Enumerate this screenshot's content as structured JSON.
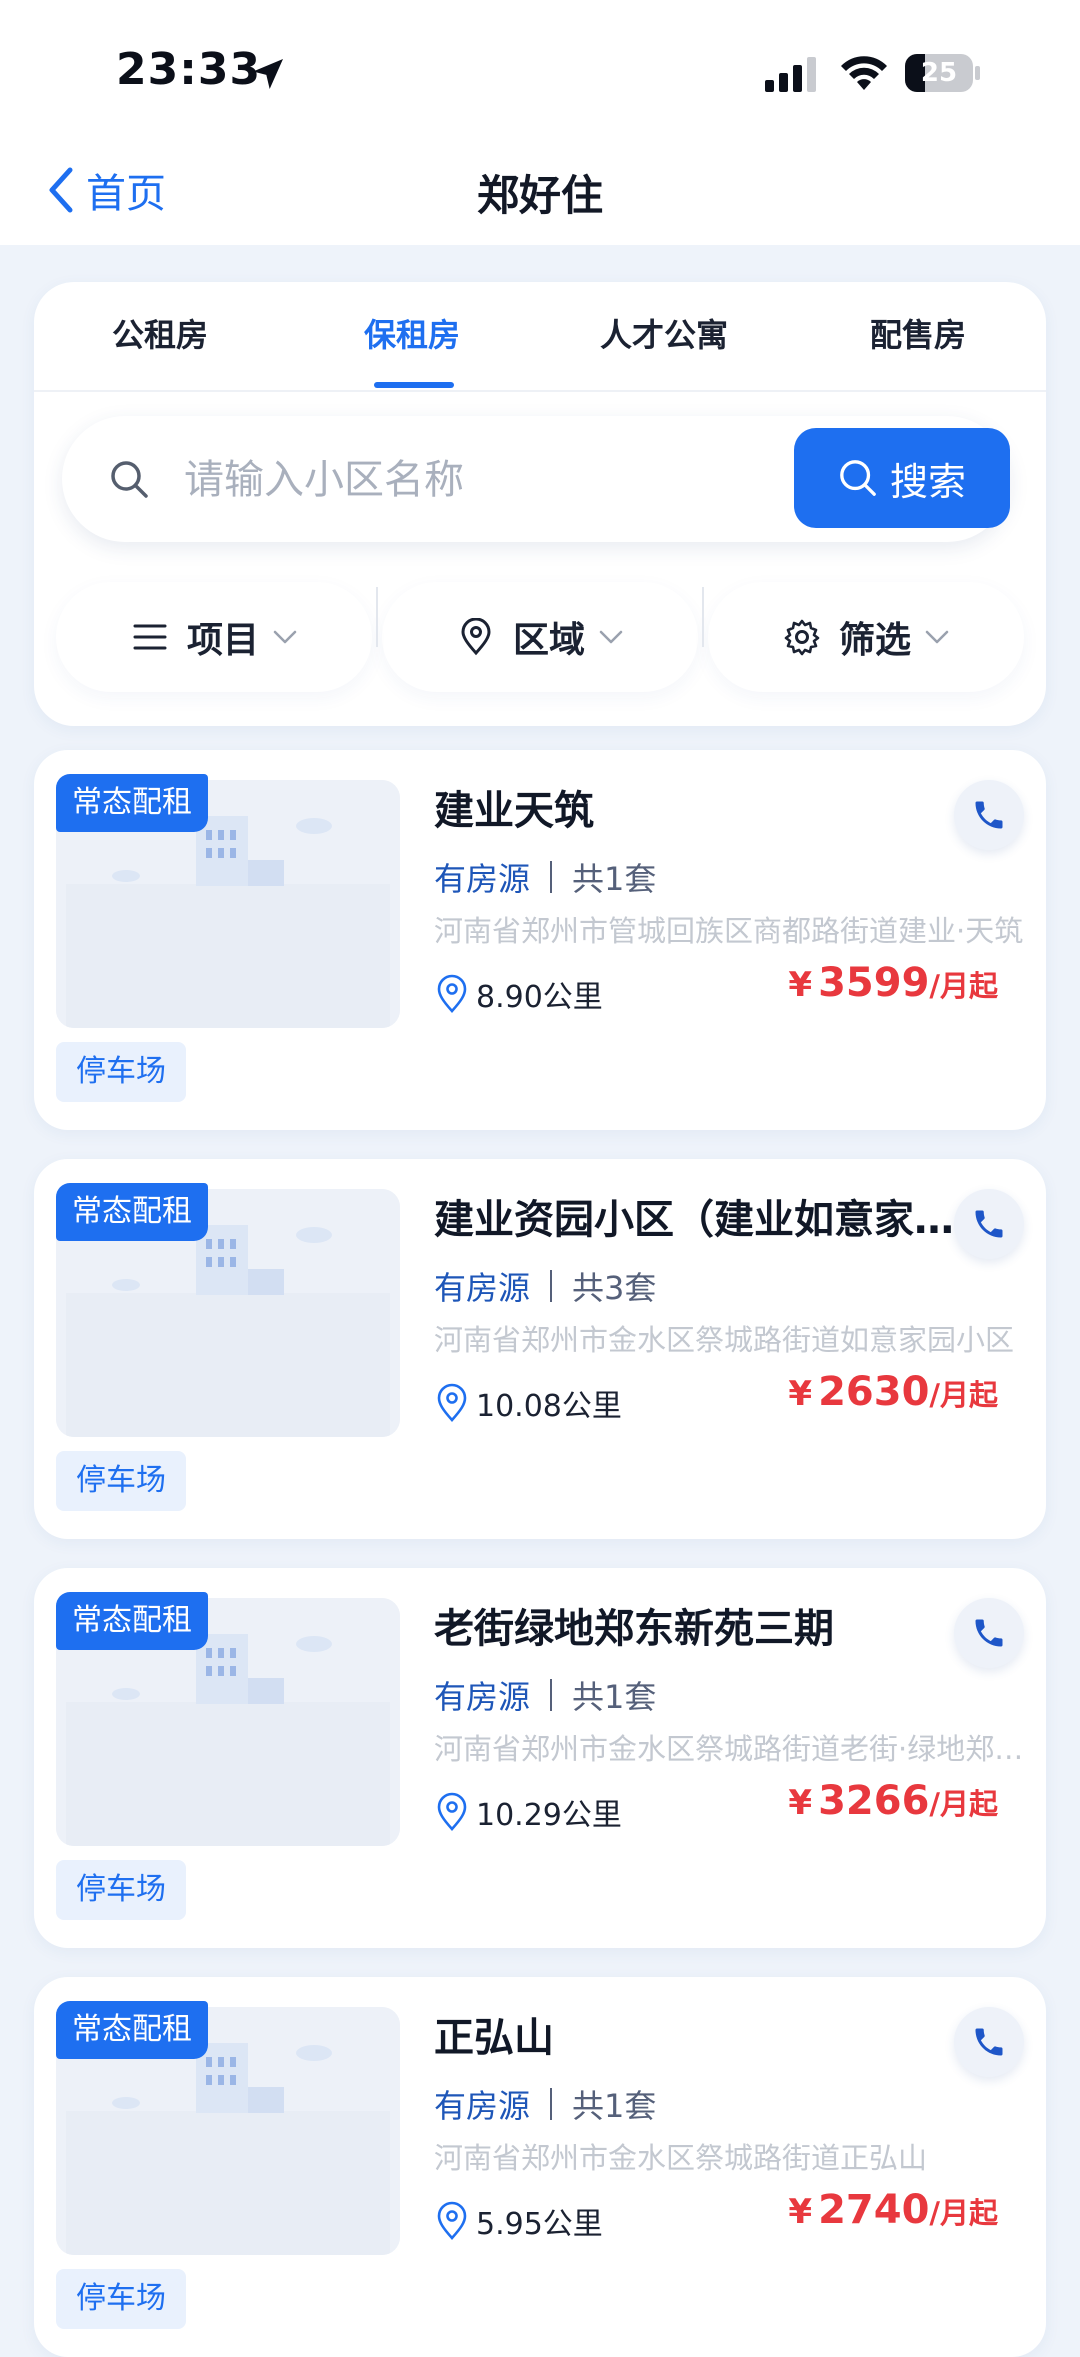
{
  "status_bar": {
    "time": "23:33",
    "battery": "25"
  },
  "nav": {
    "back_label": "首页",
    "title": "郑好住"
  },
  "tabs": [
    {
      "label": "公租房",
      "active": false
    },
    {
      "label": "保租房",
      "active": true
    },
    {
      "label": "人才公寓",
      "active": false
    },
    {
      "label": "配售房",
      "active": false
    }
  ],
  "search": {
    "placeholder": "请输入小区名称",
    "button_label": "搜索"
  },
  "filters": [
    {
      "label": "项目",
      "icon": "list-icon"
    },
    {
      "label": "区域",
      "icon": "location-pin-icon"
    },
    {
      "label": "筛选",
      "icon": "gear-icon"
    }
  ],
  "colors": {
    "accent": "#1e6ff0",
    "price": "#e8383e",
    "background": "#eef3fa"
  },
  "listings": [
    {
      "badge": "常态配租",
      "name": "建业天筑",
      "availability": "有房源",
      "count": "共1套",
      "address": "河南省郑州市管城回族区商都路街道建业·天筑",
      "distance": "8.90公里",
      "price_symbol": "¥",
      "price": "3599",
      "price_unit": "/月起",
      "tag": "停车场"
    },
    {
      "badge": "常态配租",
      "name": "建业资园小区（建业如意家园）",
      "availability": "有房源",
      "count": "共3套",
      "address": "河南省郑州市金水区祭城路街道如意家园小区",
      "distance": "10.08公里",
      "price_symbol": "¥",
      "price": "2630",
      "price_unit": "/月起",
      "tag": "停车场"
    },
    {
      "badge": "常态配租",
      "name": "老街绿地郑东新苑三期",
      "availability": "有房源",
      "count": "共1套",
      "address": "河南省郑州市金水区祭城路街道老街·绿地郑东新苑",
      "distance": "10.29公里",
      "price_symbol": "¥",
      "price": "3266",
      "price_unit": "/月起",
      "tag": "停车场"
    },
    {
      "badge": "常态配租",
      "name": "正弘山",
      "availability": "有房源",
      "count": "共1套",
      "address": "河南省郑州市金水区祭城路街道正弘山",
      "distance": "5.95公里",
      "price_symbol": "¥",
      "price": "2740",
      "price_unit": "/月起",
      "tag": "停车场"
    }
  ]
}
